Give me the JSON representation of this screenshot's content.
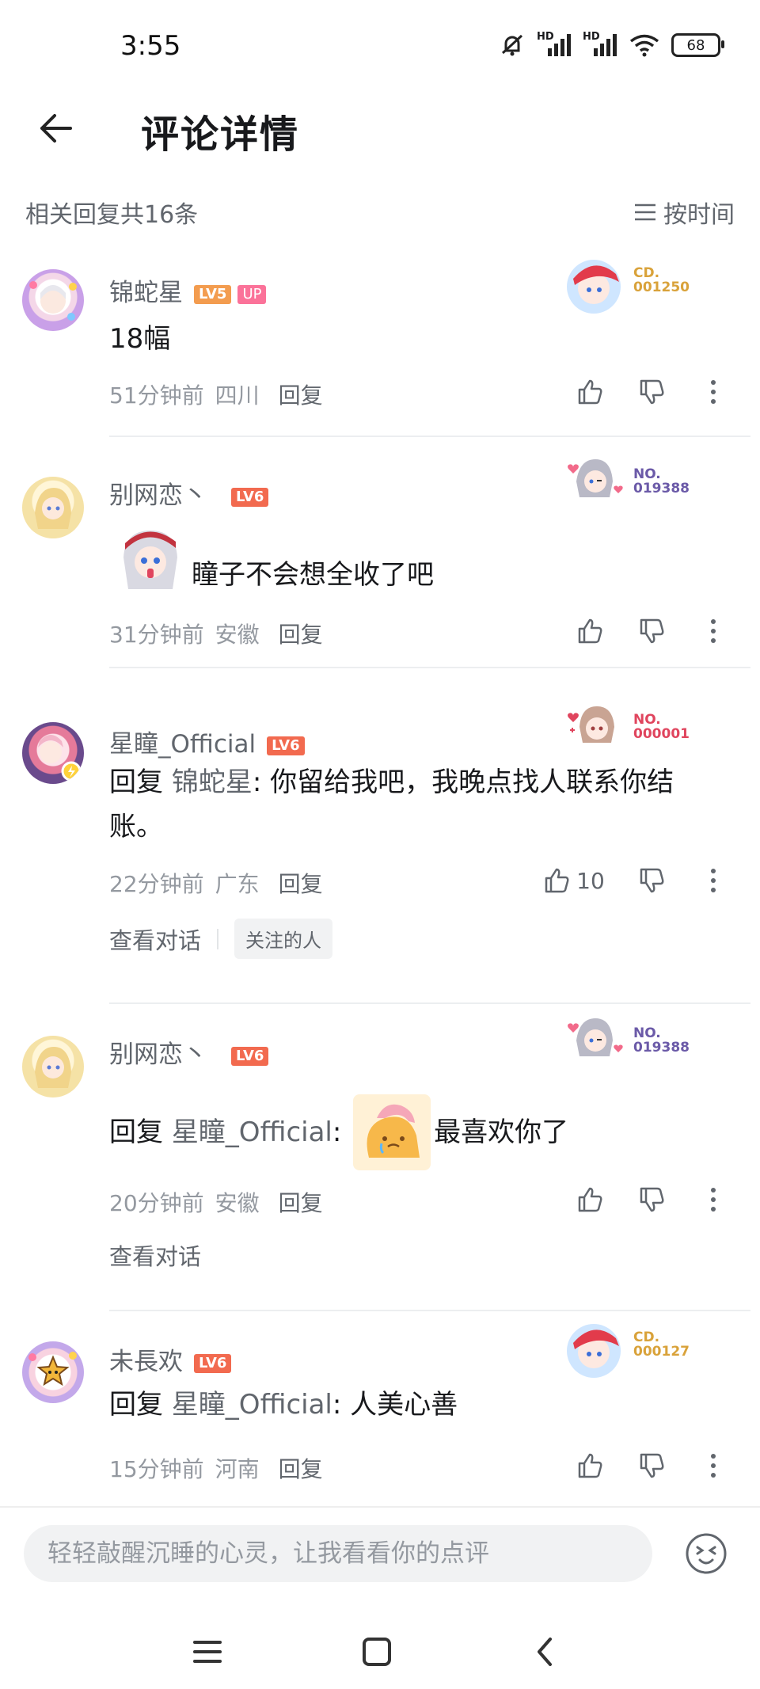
{
  "status_bar": {
    "time": "3:55",
    "battery": "68",
    "hd1": "HD",
    "hd2": "HD"
  },
  "header": {
    "title": "评论详情"
  },
  "reply_summary": {
    "count_text": "相关回复共16条",
    "sort_label": "按时间"
  },
  "comments": [
    {
      "username": "锦蛇星",
      "level": "LV5",
      "up_badge": "UP",
      "deco_label": "CD.",
      "deco_number": "001250",
      "content": "18幅",
      "time": "51分钟前",
      "location": "四川",
      "reply_label": "回复",
      "likes": ""
    },
    {
      "username": "别网恋丶",
      "level": "LV6",
      "deco_label": "NO.",
      "deco_number": "019388",
      "content": "瞳子不会想全收了吧",
      "time": "31分钟前",
      "location": "安徽",
      "reply_label": "回复",
      "likes": ""
    },
    {
      "username": "星瞳_Official",
      "level": "LV6",
      "deco_label": "NO.",
      "deco_number": "000001",
      "reply_prefix": "回复 ",
      "mention": "锦蛇星",
      "content": ": 你留给我吧，我晚点找人联系你结账。",
      "time": "22分钟前",
      "location": "广东",
      "reply_label": "回复",
      "likes": "10",
      "view_conversation": "查看对话",
      "tag": "关注的人"
    },
    {
      "username": "别网恋丶",
      "level": "LV6",
      "deco_label": "NO.",
      "deco_number": "019388",
      "reply_prefix": "回复 ",
      "mention": "星瞳_Official",
      "content_before_sticker": ": ",
      "content": "最喜欢你了",
      "time": "20分钟前",
      "location": "安徽",
      "reply_label": "回复",
      "likes": "",
      "view_conversation": "查看对话"
    },
    {
      "username": "未長欢",
      "level": "LV6",
      "deco_label": "CD.",
      "deco_number": "000127",
      "reply_prefix": "回复 ",
      "mention": "星瞳_Official",
      "content": ": 人美心善",
      "time": "15分钟前",
      "location": "河南",
      "reply_label": "回复",
      "likes": ""
    }
  ],
  "input": {
    "placeholder": "轻轻敲醒沉睡的心灵，让我看看你的点评"
  },
  "colors": {
    "accent_pink": "#fb7299",
    "level_red": "#f26a4f",
    "level_orange": "#f39c4f",
    "deco_gold": "#d9a23a",
    "deco_purple": "#6b5aa8",
    "deco_red": "#e0455e"
  }
}
